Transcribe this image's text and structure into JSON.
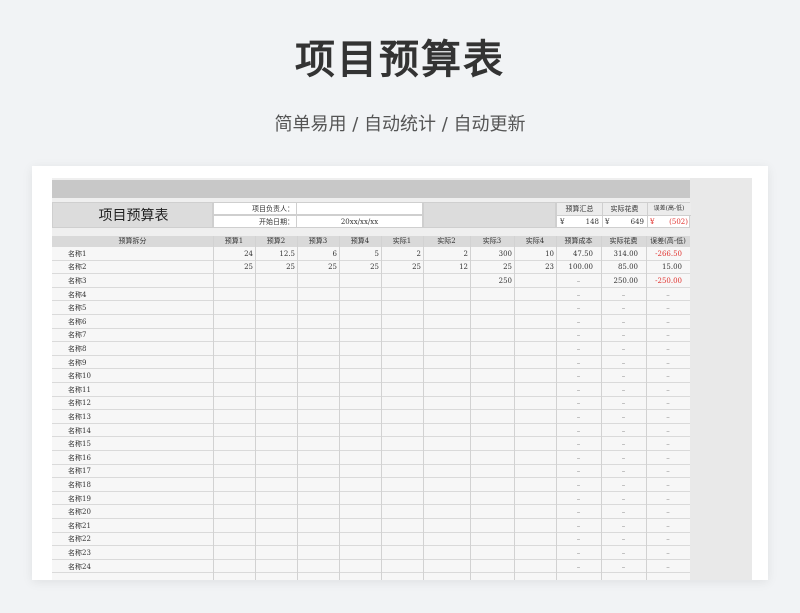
{
  "hero": {
    "title": "项目预算表",
    "subtitle": "简单易用 / 自动统计 / 自动更新"
  },
  "sheet": {
    "title": "项目预算表",
    "owner_label": "项目负责人：",
    "start_label": "开始日期：",
    "start_value": "20xx/xx/xx",
    "summary": {
      "budget_total_label": "预算汇总",
      "actual_spend_label": "实际花费",
      "diff_label": "误差(高-低)",
      "currency": "¥",
      "budget_total_value": "148",
      "actual_spend_value": "649",
      "diff_value": "(502)"
    },
    "columns": [
      "预算拆分",
      "预算1",
      "预算2",
      "预算3",
      "预算4",
      "实际1",
      "实际2",
      "实际3",
      "实际4",
      "预算成本",
      "实际花费",
      "误差(高-低)"
    ],
    "rows": [
      {
        "name": "名称1",
        "b1": "24",
        "b2": "12.5",
        "b3": "6",
        "b4": "5",
        "a1": "2",
        "a2": "2",
        "a3": "300",
        "a4": "10",
        "cost": "47.50",
        "spend": "314.00",
        "diff": "-266.50",
        "neg": true
      },
      {
        "name": "名称2",
        "b1": "25",
        "b2": "25",
        "b3": "25",
        "b4": "25",
        "a1": "25",
        "a2": "12",
        "a3": "25",
        "a4": "23",
        "cost": "100.00",
        "spend": "85.00",
        "diff": "15.00",
        "neg": false
      },
      {
        "name": "名称3",
        "b1": "",
        "b2": "",
        "b3": "",
        "b4": "",
        "a1": "",
        "a2": "",
        "a3": "250",
        "a4": "",
        "cost": "–",
        "spend": "250.00",
        "diff": "-250.00",
        "neg": true
      },
      {
        "name": "名称4",
        "b1": "",
        "b2": "",
        "b3": "",
        "b4": "",
        "a1": "",
        "a2": "",
        "a3": "",
        "a4": "",
        "cost": "–",
        "spend": "–",
        "diff": "–",
        "neg": false
      },
      {
        "name": "名称5",
        "b1": "",
        "b2": "",
        "b3": "",
        "b4": "",
        "a1": "",
        "a2": "",
        "a3": "",
        "a4": "",
        "cost": "–",
        "spend": "–",
        "diff": "–",
        "neg": false
      },
      {
        "name": "名称6",
        "b1": "",
        "b2": "",
        "b3": "",
        "b4": "",
        "a1": "",
        "a2": "",
        "a3": "",
        "a4": "",
        "cost": "–",
        "spend": "–",
        "diff": "–",
        "neg": false
      },
      {
        "name": "名称7",
        "b1": "",
        "b2": "",
        "b3": "",
        "b4": "",
        "a1": "",
        "a2": "",
        "a3": "",
        "a4": "",
        "cost": "–",
        "spend": "–",
        "diff": "–",
        "neg": false
      },
      {
        "name": "名称8",
        "b1": "",
        "b2": "",
        "b3": "",
        "b4": "",
        "a1": "",
        "a2": "",
        "a3": "",
        "a4": "",
        "cost": "–",
        "spend": "–",
        "diff": "–",
        "neg": false
      },
      {
        "name": "名称9",
        "b1": "",
        "b2": "",
        "b3": "",
        "b4": "",
        "a1": "",
        "a2": "",
        "a3": "",
        "a4": "",
        "cost": "–",
        "spend": "–",
        "diff": "–",
        "neg": false
      },
      {
        "name": "名称10",
        "b1": "",
        "b2": "",
        "b3": "",
        "b4": "",
        "a1": "",
        "a2": "",
        "a3": "",
        "a4": "",
        "cost": "–",
        "spend": "–",
        "diff": "–",
        "neg": false
      },
      {
        "name": "名称11",
        "b1": "",
        "b2": "",
        "b3": "",
        "b4": "",
        "a1": "",
        "a2": "",
        "a3": "",
        "a4": "",
        "cost": "–",
        "spend": "–",
        "diff": "–",
        "neg": false
      },
      {
        "name": "名称12",
        "b1": "",
        "b2": "",
        "b3": "",
        "b4": "",
        "a1": "",
        "a2": "",
        "a3": "",
        "a4": "",
        "cost": "–",
        "spend": "–",
        "diff": "–",
        "neg": false
      },
      {
        "name": "名称13",
        "b1": "",
        "b2": "",
        "b3": "",
        "b4": "",
        "a1": "",
        "a2": "",
        "a3": "",
        "a4": "",
        "cost": "–",
        "spend": "–",
        "diff": "–",
        "neg": false
      },
      {
        "name": "名称14",
        "b1": "",
        "b2": "",
        "b3": "",
        "b4": "",
        "a1": "",
        "a2": "",
        "a3": "",
        "a4": "",
        "cost": "–",
        "spend": "–",
        "diff": "–",
        "neg": false
      },
      {
        "name": "名称15",
        "b1": "",
        "b2": "",
        "b3": "",
        "b4": "",
        "a1": "",
        "a2": "",
        "a3": "",
        "a4": "",
        "cost": "–",
        "spend": "–",
        "diff": "–",
        "neg": false
      },
      {
        "name": "名称16",
        "b1": "",
        "b2": "",
        "b3": "",
        "b4": "",
        "a1": "",
        "a2": "",
        "a3": "",
        "a4": "",
        "cost": "–",
        "spend": "–",
        "diff": "–",
        "neg": false
      },
      {
        "name": "名称17",
        "b1": "",
        "b2": "",
        "b3": "",
        "b4": "",
        "a1": "",
        "a2": "",
        "a3": "",
        "a4": "",
        "cost": "–",
        "spend": "–",
        "diff": "–",
        "neg": false
      },
      {
        "name": "名称18",
        "b1": "",
        "b2": "",
        "b3": "",
        "b4": "",
        "a1": "",
        "a2": "",
        "a3": "",
        "a4": "",
        "cost": "–",
        "spend": "–",
        "diff": "–",
        "neg": false
      },
      {
        "name": "名称19",
        "b1": "",
        "b2": "",
        "b3": "",
        "b4": "",
        "a1": "",
        "a2": "",
        "a3": "",
        "a4": "",
        "cost": "–",
        "spend": "–",
        "diff": "–",
        "neg": false
      },
      {
        "name": "名称20",
        "b1": "",
        "b2": "",
        "b3": "",
        "b4": "",
        "a1": "",
        "a2": "",
        "a3": "",
        "a4": "",
        "cost": "–",
        "spend": "–",
        "diff": "–",
        "neg": false
      },
      {
        "name": "名称21",
        "b1": "",
        "b2": "",
        "b3": "",
        "b4": "",
        "a1": "",
        "a2": "",
        "a3": "",
        "a4": "",
        "cost": "–",
        "spend": "–",
        "diff": "–",
        "neg": false
      },
      {
        "name": "名称22",
        "b1": "",
        "b2": "",
        "b3": "",
        "b4": "",
        "a1": "",
        "a2": "",
        "a3": "",
        "a4": "",
        "cost": "–",
        "spend": "–",
        "diff": "–",
        "neg": false
      },
      {
        "name": "名称23",
        "b1": "",
        "b2": "",
        "b3": "",
        "b4": "",
        "a1": "",
        "a2": "",
        "a3": "",
        "a4": "",
        "cost": "–",
        "spend": "–",
        "diff": "–",
        "neg": false
      },
      {
        "name": "名称24",
        "b1": "",
        "b2": "",
        "b3": "",
        "b4": "",
        "a1": "",
        "a2": "",
        "a3": "",
        "a4": "",
        "cost": "–",
        "spend": "–",
        "diff": "–",
        "neg": false
      }
    ],
    "colors": {
      "negative": "#e0302c",
      "header": "#d9d9d9",
      "topbar": "#c8c8c8"
    }
  }
}
